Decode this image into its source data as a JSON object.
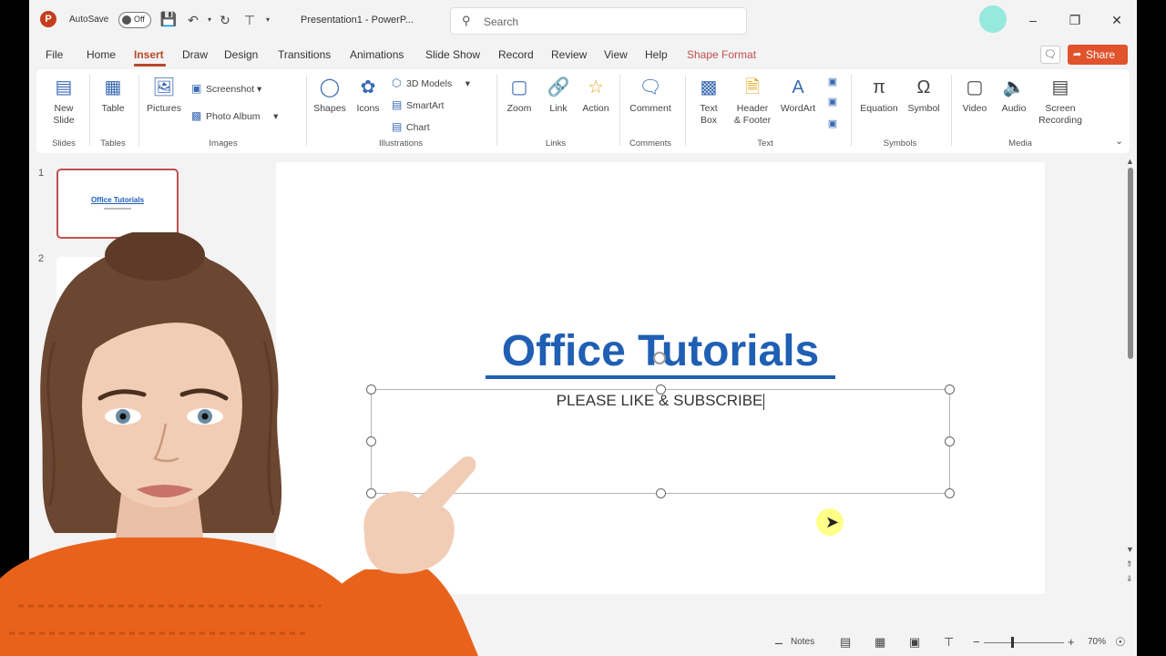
{
  "titlebar": {
    "autosave_label": "AutoSave",
    "autosave_state": "Off",
    "doc_title": "Presentation1 - PowerP...",
    "search_placeholder": "Search",
    "minimize": "–",
    "restore": "❐",
    "close": "✕"
  },
  "tabs": [
    {
      "label": "File"
    },
    {
      "label": "Home"
    },
    {
      "label": "Insert"
    },
    {
      "label": "Draw"
    },
    {
      "label": "Design"
    },
    {
      "label": "Transitions"
    },
    {
      "label": "Animations"
    },
    {
      "label": "Slide Show"
    },
    {
      "label": "Record"
    },
    {
      "label": "Review"
    },
    {
      "label": "View"
    },
    {
      "label": "Help"
    },
    {
      "label": "Shape Format"
    }
  ],
  "share_label": "Share",
  "ribbon": {
    "new_slide": "New\nSlide",
    "table": "Table",
    "pictures": "Pictures",
    "screenshot": "Screenshot",
    "photo_album": "Photo Album",
    "shapes": "Shapes",
    "icons": "Icons",
    "models_3d": "3D Models",
    "smartart": "SmartArt",
    "chart": "Chart",
    "zoom": "Zoom",
    "link": "Link",
    "action": "Action",
    "comment": "Comment",
    "text_box": "Text\nBox",
    "header_footer": "Header\n& Footer",
    "wordart": "WordArt",
    "equation": "Equation",
    "symbol": "Symbol",
    "video": "Video",
    "audio": "Audio",
    "screen_recording": "Screen\nRecording",
    "groups": {
      "slides": "Slides",
      "tables": "Tables",
      "images": "Images",
      "illustrations": "Illustrations",
      "links": "Links",
      "comments": "Comments",
      "text": "Text",
      "symbols": "Symbols",
      "media": "Media"
    }
  },
  "thumbnails": [
    {
      "number": "1",
      "title": "Office Tutorials"
    },
    {
      "number": "2"
    }
  ],
  "slide": {
    "title": "Office Tutorials",
    "subtitle": "PLEASE LIKE & SUBSCRIBE"
  },
  "statusbar": {
    "notes": "Notes",
    "zoom": "70%"
  },
  "colors": {
    "accent": "#b7472a",
    "share": "#e0532c",
    "title_blue": "#1f5fb4",
    "sweater": "#e8621c"
  }
}
